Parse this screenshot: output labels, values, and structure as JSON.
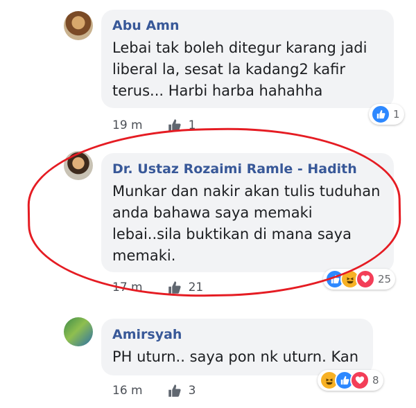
{
  "comments": [
    {
      "author": "Abu Amn",
      "text": "Lebai tak boleh ditegur karang jadi liberal la, sesat la kadang2 kafir terus... Harbi harba hahahha",
      "time": "19 m",
      "like_count": "1",
      "reaction_count": "1",
      "reactions": [
        "like-icon"
      ]
    },
    {
      "author": "Dr. Ustaz Rozaimi Ramle - Hadith",
      "text": "Munkar dan nakir akan tulis tuduhan anda bahawa saya memaki lebai..sila buktikan di mana saya memaki.",
      "time": "17 m",
      "like_count": "21",
      "reaction_count": "25",
      "reactions": [
        "like-icon",
        "haha-icon",
        "love-icon"
      ]
    },
    {
      "author": "Amirsyah",
      "text": "PH uturn.. saya pon nk uturn. Kan",
      "time": "16 m",
      "like_count": "3",
      "reaction_count": "8",
      "reactions": [
        "haha-icon",
        "like-icon",
        "love-icon"
      ]
    }
  ],
  "colors": {
    "author_name": "#385898",
    "bubble_bg": "#f2f3f5",
    "highlight": "#e51c23",
    "like_blue": "#2d88ff",
    "haha_yellow": "#f7b125",
    "love_red": "#f33e58"
  }
}
